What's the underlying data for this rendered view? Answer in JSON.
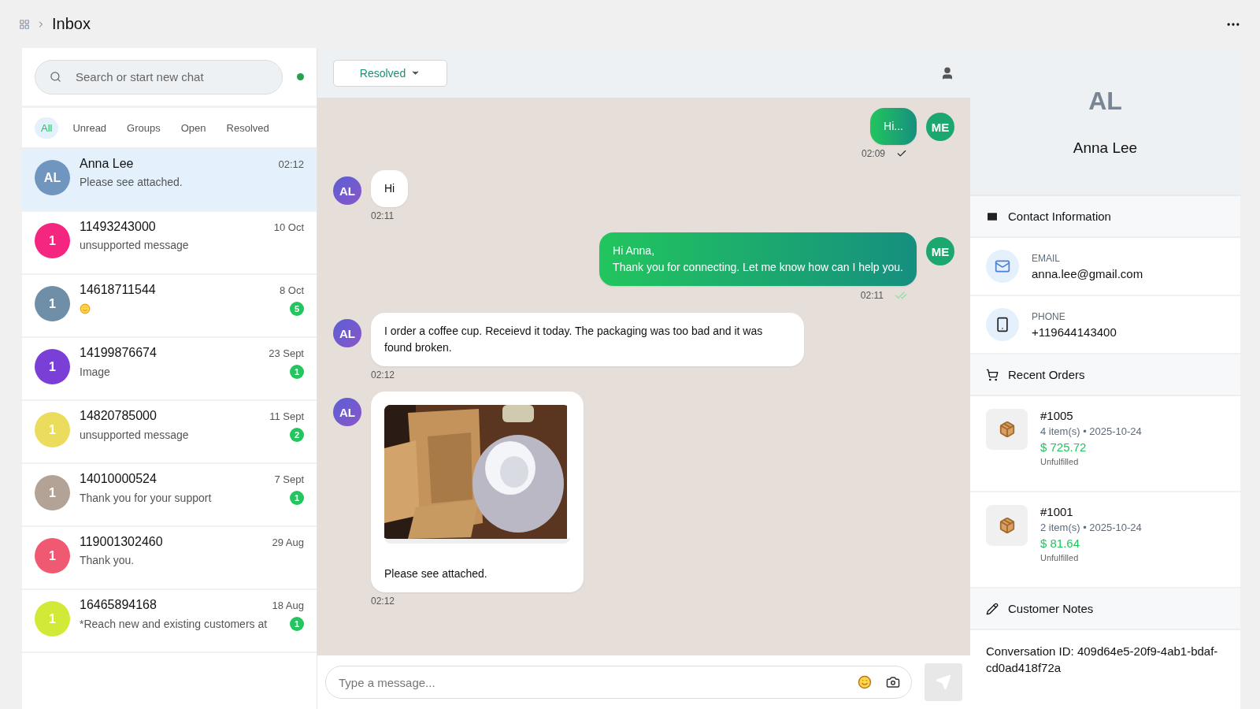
{
  "header": {
    "title": "Inbox"
  },
  "search": {
    "placeholder": "Search or start new chat",
    "online": true
  },
  "filters": [
    {
      "label": "All",
      "selected": true
    },
    {
      "label": "Unread",
      "selected": false
    },
    {
      "label": "Groups",
      "selected": false
    },
    {
      "label": "Open",
      "selected": false
    },
    {
      "label": "Resolved",
      "selected": false
    }
  ],
  "chats": [
    {
      "initials": "AL",
      "name": "Anna Lee",
      "preview": "Please see attached.",
      "time": "02:12",
      "selected": true,
      "color": "#7096bf"
    },
    {
      "initials": "1",
      "name": "11493243000",
      "preview": "unsupported message",
      "time": "10 Oct",
      "selected": false,
      "color": "#f5267f"
    },
    {
      "initials": "1",
      "name": "14618711544",
      "time": "8 Oct",
      "unread": "5",
      "selected": false,
      "color": "#6f8ea8"
    },
    {
      "initials": "1",
      "name": "14199876674",
      "preview": "Image",
      "time": "23 Sept",
      "unread": "1",
      "selected": false,
      "color": "#7a3fd6"
    },
    {
      "initials": "1",
      "name": "14820785000",
      "preview": "unsupported message",
      "time": "11 Sept",
      "unread": "2",
      "selected": false,
      "color": "#ecdc5e"
    },
    {
      "initials": "1",
      "name": "14010000524",
      "preview": "Thank you for your support",
      "time": "7 Sept",
      "unread": "1",
      "selected": false,
      "color": "#b3a396"
    },
    {
      "initials": "1",
      "name": "119001302460",
      "preview": "Thank you.",
      "time": "29 Aug",
      "selected": false,
      "color": "#ef5a72"
    },
    {
      "initials": "1",
      "name": "16465894168",
      "preview": "*Reach new and existing customers at",
      "time": "18 Aug",
      "unread": "1",
      "selected": false,
      "color": "#d3e937"
    }
  ],
  "conversation": {
    "status": "Resolved",
    "messages": [
      {
        "kind": "outgoing",
        "avatar": "ME",
        "lines": [
          "Hi..."
        ],
        "time": "02:09",
        "read": false
      },
      {
        "kind": "incoming",
        "avatar": "AL",
        "lines": [
          "Hi"
        ],
        "time": "02:11"
      },
      {
        "kind": "outgoing",
        "avatar": "ME",
        "lines": [
          "Hi Anna,",
          "Thank you for connecting. Let me know how can I help you."
        ],
        "time": "02:11",
        "read": true
      },
      {
        "kind": "incoming",
        "avatar": "AL",
        "lines": [
          "I order a coffee cup. Receievd it today. The packaging was too bad and it was found broken."
        ],
        "time": "02:12"
      },
      {
        "kind": "incoming",
        "avatar": "AL",
        "image": true,
        "lines": [
          "Please see attached."
        ],
        "time": "02:12"
      }
    ],
    "composer": {
      "placeholder": "Type a message..."
    }
  },
  "contact": {
    "initials": "AL",
    "name": "Anna Lee",
    "info_title": "Contact Information",
    "fields": [
      {
        "kind": "email",
        "label": "EMAIL",
        "value": "anna.lee@gmail.com"
      },
      {
        "kind": "phone",
        "label": "PHONE",
        "value": "+119644143400"
      }
    ],
    "orders_title": "Recent Orders",
    "orders": [
      {
        "number": "#1005",
        "meta": "4 item(s) • 2025-10-24",
        "total": "$ 725.72",
        "status": "Unfulfilled"
      },
      {
        "number": "#1001",
        "meta": "2 item(s) • 2025-10-24",
        "total": "$ 81.64",
        "status": "Unfulfilled"
      }
    ],
    "notes_title": "Customer Notes",
    "note": "Conversation ID: 409d64e5-20f9-4ab1-bdaf-cd0ad418f72a"
  }
}
